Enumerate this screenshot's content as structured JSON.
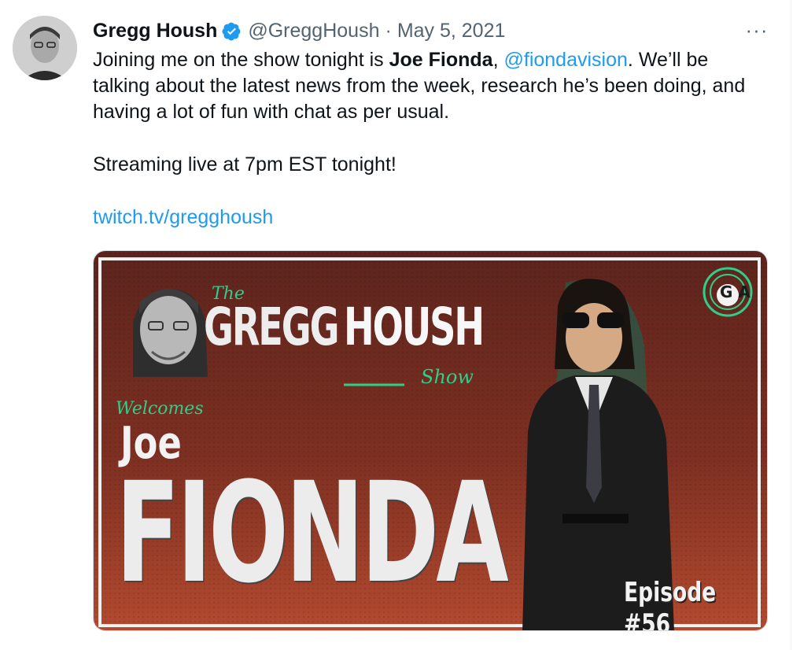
{
  "tweet": {
    "author_name": "Gregg Housh",
    "handle": "@GreggHoush",
    "separator": "·",
    "date": "May 5, 2021",
    "more_label": "···",
    "text": {
      "line1_a": "Joining me on the show tonight is ",
      "line1_bold": "Joe Fionda",
      "line1_comma": ", ",
      "mention": "@fiondavision",
      "line1_b": ". We’ll be talking about the latest news from the week, research he’s been doing, and having a lot of fun with chat as per usual.",
      "line2": "Streaming live at 7pm EST tonight!",
      "link": "twitch.tv/gregghoush"
    }
  },
  "media": {
    "the": "The",
    "gregg": "GREGG",
    "housh": "HOUSH",
    "show": "Show",
    "welcomes": "Welcomes",
    "joe": "Joe",
    "fionda": "FIONDA",
    "episode": "Episode #56",
    "logo": "G A"
  },
  "colors": {
    "link": "#1d9bf0",
    "verified": "#1d9bf0",
    "banner_top": "#6b2a22",
    "banner_bottom": "#a8432c",
    "accent_green": "#2ecf8a"
  },
  "icons": {
    "verified": "verified-badge-icon",
    "more": "more-dots-icon"
  }
}
